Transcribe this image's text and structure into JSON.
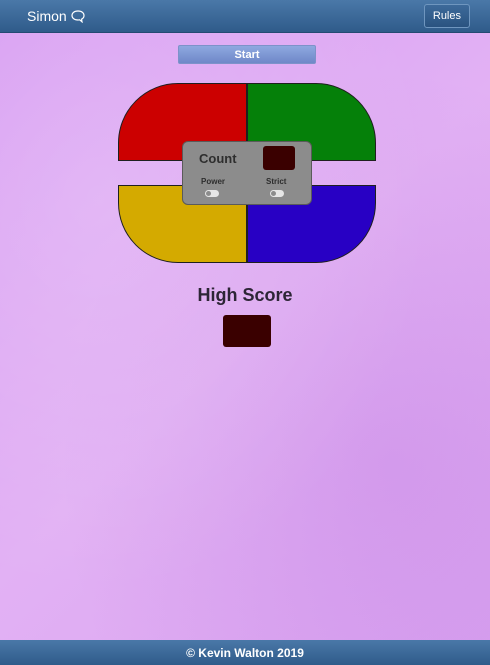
{
  "navbar": {
    "brand": "Simon",
    "brand_icon": "speech-bubble-icon",
    "rules_label": "Rules",
    "colors": {
      "bar": "#2f5b8a"
    }
  },
  "start_label": "Start",
  "board": {
    "pads": [
      {
        "name": "red",
        "color": "#cc0000"
      },
      {
        "name": "green",
        "color": "#058009"
      },
      {
        "name": "yellow",
        "color": "#d4aa00"
      },
      {
        "name": "blue",
        "color": "#2800c4"
      }
    ],
    "count_label": "Count",
    "count_value": "",
    "power_label": "Power",
    "strict_label": "Strict"
  },
  "high_score": {
    "title": "High Score",
    "value": ""
  },
  "footer": {
    "text": "© Kevin Walton 2019"
  }
}
